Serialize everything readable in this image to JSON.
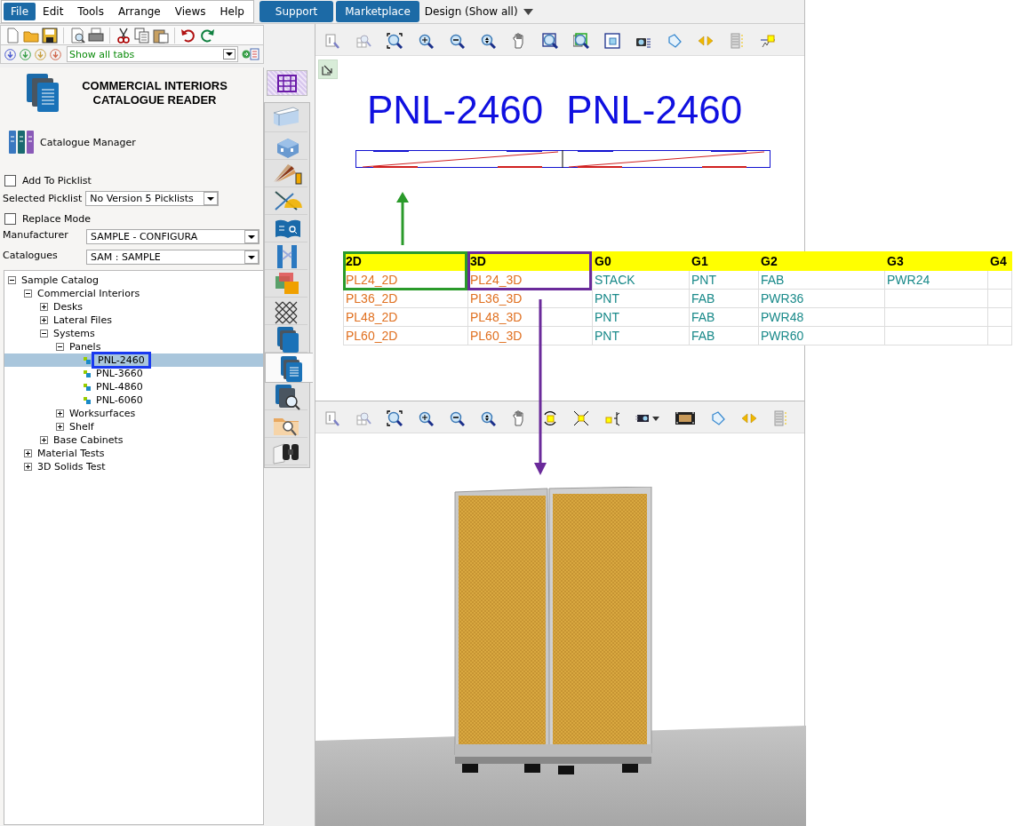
{
  "menu_bar": {
    "items": [
      {
        "label": "File",
        "selected": true
      },
      {
        "label": "Edit",
        "selected": false
      },
      {
        "label": "Tools",
        "selected": false
      },
      {
        "label": "Arrange",
        "selected": false
      },
      {
        "label": "Views",
        "selected": false
      },
      {
        "label": "Help",
        "selected": false
      }
    ],
    "buttons": [
      "Support",
      "Marketplace"
    ],
    "view_mode": "Design (Show all)"
  },
  "tab_filter": "Show all tabs",
  "catalogue_reader": {
    "title": [
      "COMMERCIAL INTERIORS",
      "CATALOGUE READER"
    ],
    "catalogue_manager": "Catalogue Manager",
    "add_to_picklist": {
      "label": "Add To Picklist",
      "checked": false
    },
    "selected_picklist": {
      "label": "Selected Picklist",
      "value": "No Version 5 Picklists"
    },
    "replace_mode": {
      "label": "Replace Mode",
      "checked": false
    },
    "manufacturer": {
      "label": "Manufacturer",
      "value": "SAMPLE - CONFIGURA"
    },
    "catalogues": {
      "label": "Catalogues",
      "value": "SAM : SAMPLE"
    }
  },
  "tree": [
    {
      "label": "Sample Catalog",
      "kind": "folder",
      "expanded": true,
      "children": [
        {
          "label": "Commercial Interiors",
          "kind": "folder",
          "expanded": true,
          "children": [
            {
              "label": "Desks",
              "kind": "folder",
              "expanded": false
            },
            {
              "label": "Lateral Files",
              "kind": "folder",
              "expanded": false
            },
            {
              "label": "Systems",
              "kind": "folder",
              "expanded": true,
              "children": [
                {
                  "label": "Panels",
                  "kind": "folder",
                  "expanded": true,
                  "children": [
                    {
                      "label": "PNL-2460",
                      "kind": "item",
                      "selected": true
                    },
                    {
                      "label": "PNL-3660",
                      "kind": "item",
                      "selected": false
                    },
                    {
                      "label": "PNL-4860",
                      "kind": "item",
                      "selected": false
                    },
                    {
                      "label": "PNL-6060",
                      "kind": "item",
                      "selected": false
                    }
                  ]
                },
                {
                  "label": "Worksurfaces",
                  "kind": "folder",
                  "expanded": false
                },
                {
                  "label": "Shelf",
                  "kind": "folder",
                  "expanded": false
                }
              ]
            },
            {
              "label": "Base Cabinets",
              "kind": "folder",
              "expanded": false
            }
          ]
        },
        {
          "label": "Material Tests",
          "kind": "folder",
          "expanded": false
        },
        {
          "label": "3D Solids Test",
          "kind": "folder",
          "expanded": false
        }
      ]
    }
  ],
  "side_tabs": [
    {
      "kind": "wall",
      "selected": false
    },
    {
      "kind": "building",
      "selected": false
    },
    {
      "kind": "swatch",
      "selected": false
    },
    {
      "kind": "drafting",
      "selected": false
    },
    {
      "kind": "book",
      "selected": false
    },
    {
      "kind": "rack",
      "selected": false
    },
    {
      "kind": "blocks",
      "selected": false
    },
    {
      "kind": "mesh",
      "selected": false
    },
    {
      "kind": "catalog",
      "selected": false
    },
    {
      "kind": "reader",
      "selected": true
    },
    {
      "kind": "search",
      "selected": false
    },
    {
      "kind": "folder",
      "selected": false
    },
    {
      "kind": "binoculars",
      "selected": false
    }
  ],
  "plan_view": {
    "labels": [
      "PNL-2460",
      "PNL-2460"
    ]
  },
  "picklist_table": {
    "columns": [
      "2D",
      "3D",
      "G0",
      "G1",
      "G2",
      "G3",
      "G4"
    ],
    "rows": [
      [
        "PL24_2D",
        "PL24_3D",
        "STACK",
        "PNT",
        "FAB",
        "PWR24"
      ],
      [
        "PL36_2D",
        "PL36_3D",
        "PNT",
        "FAB",
        "PWR36"
      ],
      [
        "PL48_2D",
        "PL48_3D",
        "PNT",
        "FAB",
        "PWR48"
      ],
      [
        "PL60_2D",
        "PL60_3D",
        "PNT",
        "FAB",
        "PWR60"
      ]
    ]
  }
}
